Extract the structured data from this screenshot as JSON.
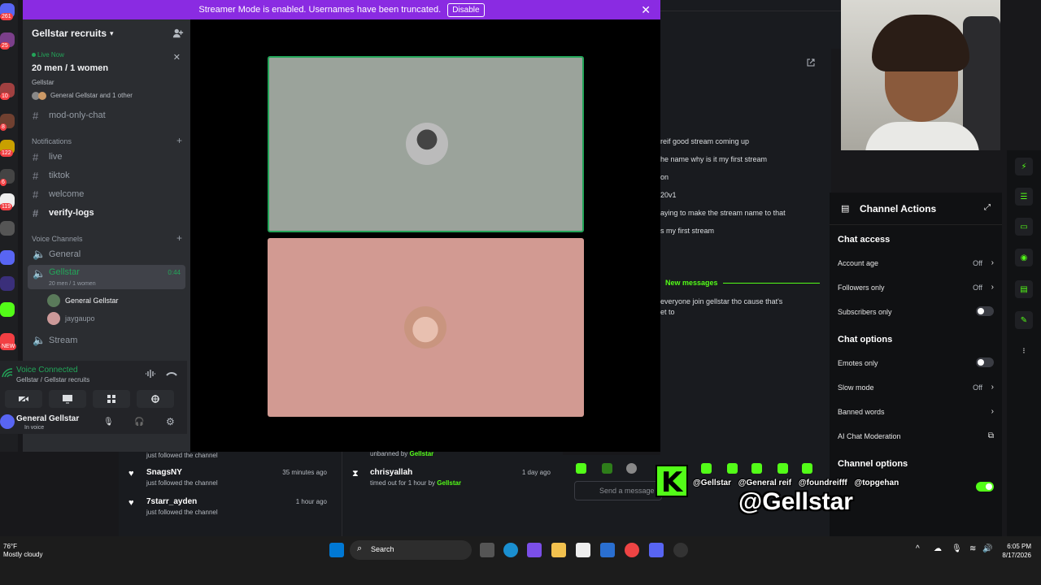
{
  "streamer_banner": {
    "text": "Streamer Mode is enabled. Usernames have been truncated.",
    "disable_label": "Disable"
  },
  "server": {
    "name": "Gellstar recruits"
  },
  "live_card": {
    "label": "Live Now",
    "title": "20 men / 1 women",
    "host": "Gellstar",
    "participants": "General Gellstar and 1 other"
  },
  "channels_top": [
    {
      "label": "mod-only-chat"
    }
  ],
  "notifications_category": "Notifications",
  "text_channels": [
    {
      "label": "live",
      "unread": false
    },
    {
      "label": "tiktok",
      "unread": false
    },
    {
      "label": "welcome",
      "unread": false
    },
    {
      "label": "verify-logs",
      "unread": true
    }
  ],
  "voice_category": "Voice Channels",
  "voice_channels": {
    "general": "General",
    "active": {
      "label": "Gellstar",
      "subtitle": "20 men / 1 women",
      "timer": "0:44"
    },
    "users": [
      "General Gellstar",
      "jaygaupo"
    ],
    "stream": "Stream"
  },
  "voice_panel": {
    "status": "Voice Connected",
    "channel": "Gellstar / Gellstar recruits"
  },
  "user_panel": {
    "name": "General Gellstar",
    "status": "In voice"
  },
  "server_rail_badges": [
    "261",
    "25",
    "10",
    "8",
    "122",
    "6",
    "119",
    "NEW"
  ],
  "chat": {
    "lines": [
      "reif good stream coming up",
      "he name why is it my first stream",
      "on",
      "20v1",
      "aying to make the stream name to that",
      "s my first stream"
    ],
    "new_messages_label": "New messages",
    "after_lines": [
      "everyone join gellstar tho cause that's",
      "et to"
    ]
  },
  "channel_actions": {
    "title": "Channel Actions",
    "chat_access": "Chat access",
    "rows_access": [
      {
        "label": "Account age",
        "value": "Off",
        "kind": "chevron"
      },
      {
        "label": "Followers only",
        "value": "Off",
        "kind": "chevron"
      },
      {
        "label": "Subscribers only",
        "value": "",
        "kind": "toggle"
      }
    ],
    "chat_options": "Chat options",
    "rows_options": [
      {
        "label": "Emotes only",
        "value": "",
        "kind": "toggle"
      },
      {
        "label": "Slow mode",
        "value": "Off",
        "kind": "chevron"
      },
      {
        "label": "Banned words",
        "value": "",
        "kind": "chevron"
      },
      {
        "label": "AI Chat Moderation",
        "value": "",
        "kind": "external"
      }
    ],
    "channel_options": "Channel options"
  },
  "activity": {
    "col1": [
      {
        "name": "",
        "desc": "just followed the channel",
        "time": ""
      },
      {
        "name": "SnagsNY",
        "desc": "just followed the channel",
        "time": "35 minutes ago"
      },
      {
        "name": "7starr_ayden",
        "desc": "just followed the channel",
        "time": "1 hour ago"
      }
    ],
    "col2_top": {
      "prefix": "unbanned by",
      "by": "Gellstar"
    },
    "col2": {
      "name": "chrisyallah",
      "desc_prefix": "timed out for 1 hour by",
      "by": "Gellstar",
      "time": "1 day ago"
    }
  },
  "chat_input_placeholder": "Send a message",
  "overlay": {
    "socials": [
      "@Gellstar",
      "@General reif",
      "@foundreifff",
      "@topgehan"
    ],
    "handle": "@Gellstar"
  },
  "taskbar": {
    "weather_temp": "76°F",
    "weather_desc": "Mostly cloudy",
    "search_label": "Search",
    "time": "6:05 PM",
    "date": "8/17/2026"
  },
  "colors": {
    "discord_purple": "#8a2be2",
    "kick_green": "#53fc18",
    "discord_green": "#23a559"
  }
}
